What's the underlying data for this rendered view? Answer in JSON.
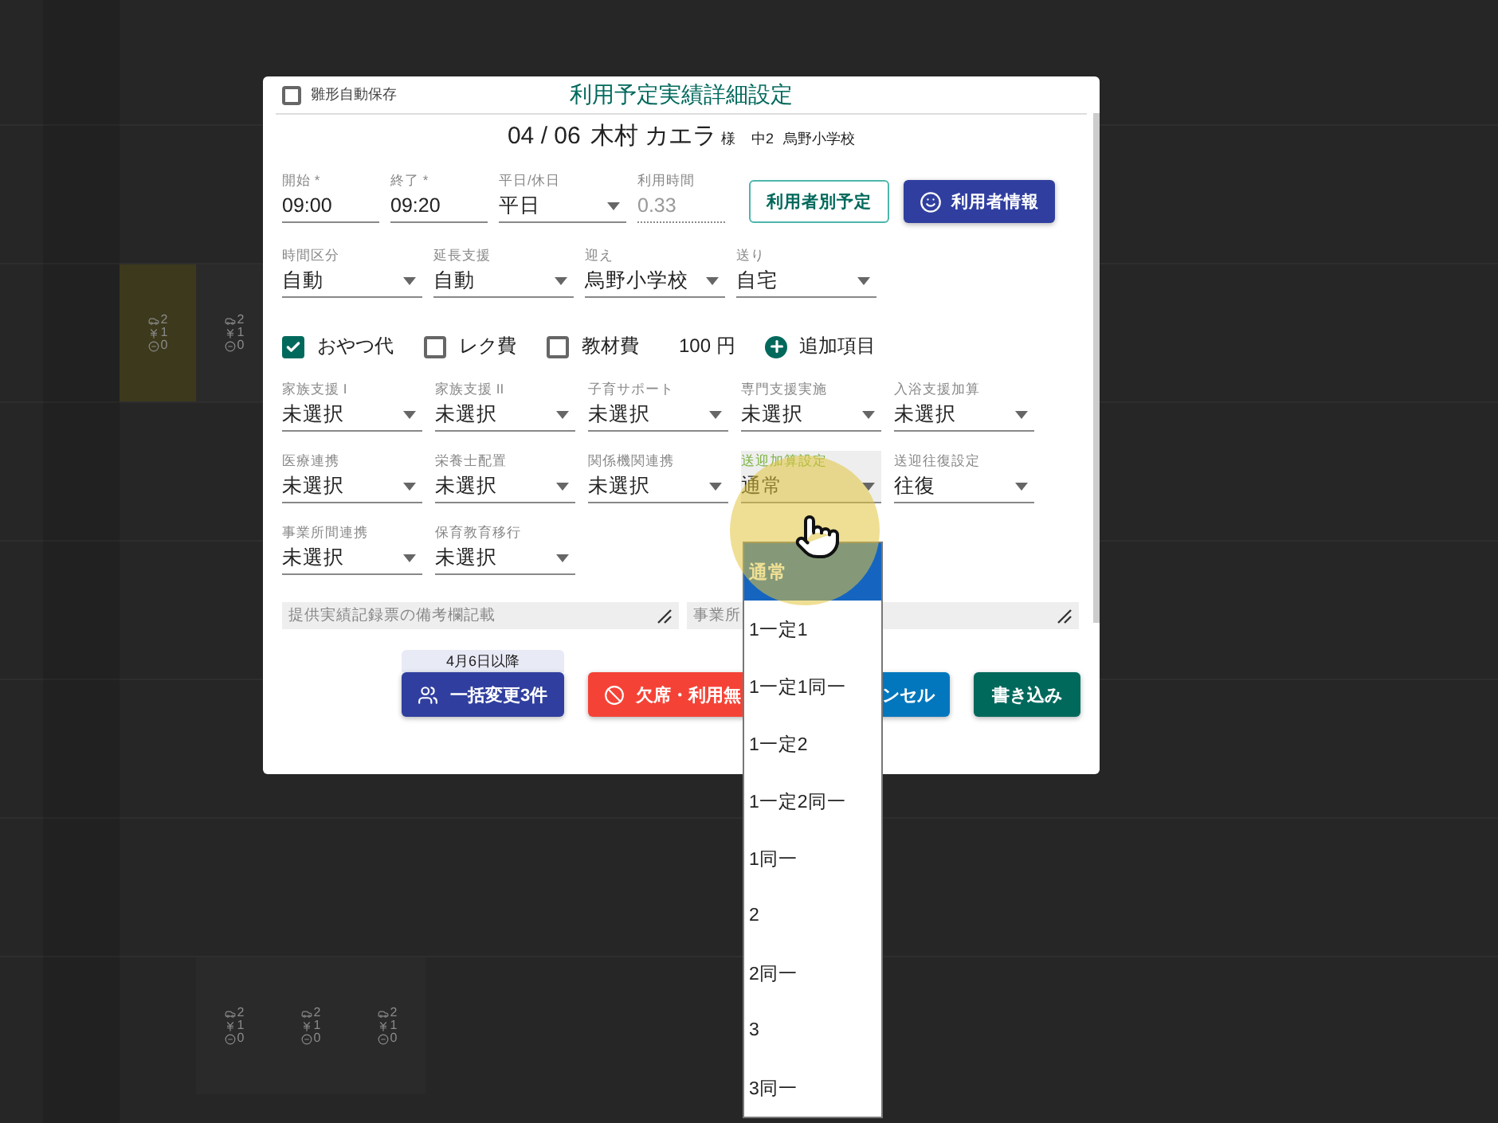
{
  "calendar": {
    "weeks": [
      {
        "days": [
          {
            "lines": [
              {
                "kind": "car",
                "text": "2"
              },
              {
                "kind": "yen",
                "text": "1"
              },
              {
                "kind": "minus",
                "text": "0"
              }
            ],
            "highlighted": true
          },
          {
            "lines": [
              {
                "kind": "car",
                "text": "2"
              },
              {
                "kind": "yen",
                "text": "1"
              },
              {
                "kind": "minus",
                "text": "0"
              }
            ],
            "highlighted": false
          }
        ]
      },
      {
        "days": [
          {
            "lines": [
              {
                "kind": "car",
                "text": "2"
              },
              {
                "kind": "yen",
                "text": "1"
              },
              {
                "kind": "minus",
                "text": "0"
              }
            ],
            "highlighted": false
          },
          {
            "lines": [
              {
                "kind": "car",
                "text": "2"
              },
              {
                "kind": "yen",
                "text": "1"
              },
              {
                "kind": "minus",
                "text": "0"
              }
            ],
            "highlighted": false
          },
          {
            "lines": [
              {
                "kind": "car",
                "text": "2"
              },
              {
                "kind": "yen",
                "text": "1"
              },
              {
                "kind": "minus",
                "text": "0"
              }
            ],
            "highlighted": false
          }
        ]
      }
    ]
  },
  "dialog": {
    "autosave": {
      "label": "雛形自動保存",
      "checked": false
    },
    "title": "利用予定実績詳細設定",
    "header": {
      "date": "04 / 06",
      "name": "木村 カエラ",
      "honorific": "様",
      "grade": "中2",
      "school": "烏野小学校"
    },
    "time_fields": [
      {
        "kind": "text",
        "label": "開始 *",
        "value": "09:00"
      },
      {
        "kind": "text",
        "label": "終了 *",
        "value": "09:20"
      },
      {
        "kind": "select",
        "label": "平日/休日",
        "value": "平日"
      },
      {
        "kind": "readonly",
        "label": "利用時間",
        "value": "0.33"
      }
    ],
    "top_buttons": [
      {
        "kind": "outlined",
        "label": "利用者別予定"
      },
      {
        "kind": "primary",
        "label": "利用者情報"
      }
    ],
    "transport_fields": [
      {
        "label": "時間区分",
        "value": "自動"
      },
      {
        "label": "延長支援",
        "value": "自動"
      },
      {
        "label": "迎え",
        "value": "烏野小学校"
      },
      {
        "label": "送り",
        "value": "自宅"
      }
    ],
    "fees": [
      {
        "label": "おやつ代",
        "checked": true
      },
      {
        "label": "レク費",
        "checked": false
      },
      {
        "label": "教材費",
        "checked": false
      }
    ],
    "fee_amount": "100 円",
    "add_item": "追加項目",
    "additions": [
      {
        "label": "家族支援 I",
        "value": "未選択",
        "focused": false
      },
      {
        "label": "家族支援 II",
        "value": "未選択",
        "focused": false
      },
      {
        "label": "子育サポート",
        "value": "未選択",
        "focused": false
      },
      {
        "label": "専門支援実施",
        "value": "未選択",
        "focused": false
      },
      {
        "label": "入浴支援加算",
        "value": "未選択",
        "focused": false
      },
      {
        "label": "医療連携",
        "value": "未選択",
        "focused": false
      },
      {
        "label": "栄養士配置",
        "value": "未選択",
        "focused": false
      },
      {
        "label": "関係機関連携",
        "value": "未選択",
        "focused": false
      },
      {
        "label": "送迎加算設定",
        "value": "通常",
        "focused": true
      },
      {
        "label": "送迎往復設定",
        "value": "往復",
        "focused": false
      },
      {
        "label": "事業所間連携",
        "value": "未選択",
        "focused": false
      },
      {
        "label": "保育教育移行",
        "value": "未選択",
        "focused": false
      }
    ],
    "notes": [
      {
        "placeholder": "提供実績記録票の備考欄記載"
      },
      {
        "placeholder": "事業所"
      }
    ],
    "actions": [
      {
        "kind": "bulk",
        "caption": "4月6日以降",
        "label": "一括変更3件"
      },
      {
        "kind": "absent",
        "label": "欠席・利用無"
      },
      {
        "kind": "cancel",
        "label": "ンセル"
      },
      {
        "kind": "write",
        "label": "書き込み"
      }
    ]
  },
  "menu": {
    "items": [
      {
        "label": "通常",
        "selected": true
      },
      {
        "label": "1一定1",
        "selected": false
      },
      {
        "label": "1一定1同一",
        "selected": false
      },
      {
        "label": "1一定2",
        "selected": false
      },
      {
        "label": "1一定2同一",
        "selected": false
      },
      {
        "label": "1同一",
        "selected": false
      },
      {
        "label": "2",
        "selected": false
      },
      {
        "label": "2同一",
        "selected": false
      },
      {
        "label": "3",
        "selected": false
      },
      {
        "label": "3同一",
        "selected": false
      }
    ]
  }
}
